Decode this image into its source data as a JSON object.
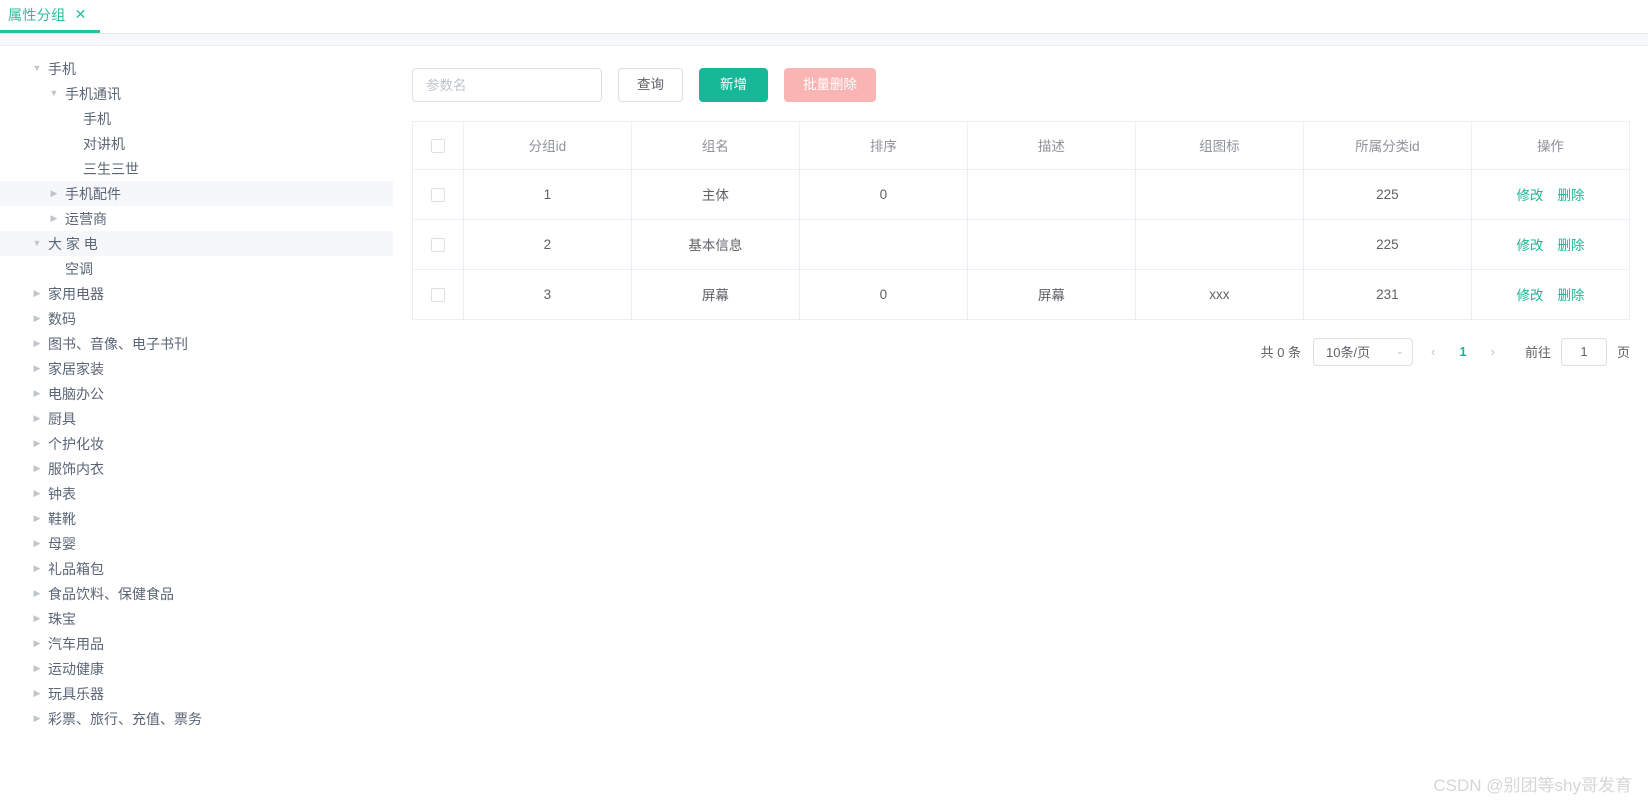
{
  "tab": {
    "label": "属性分组",
    "close_icon": "close-icon",
    "close_glyph": "✕"
  },
  "accent": {
    "teal": "#17b897",
    "pink": "#f9b4b4",
    "highlight": "#f5f7fa"
  },
  "sidebar": {
    "items": [
      {
        "label": "手机",
        "level": 0,
        "caret": "down",
        "highlight": false
      },
      {
        "label": "手机通讯",
        "level": 1,
        "caret": "down",
        "highlight": false
      },
      {
        "label": "手机",
        "level": 2,
        "caret": "none",
        "highlight": false
      },
      {
        "label": "对讲机",
        "level": 2,
        "caret": "none",
        "highlight": false
      },
      {
        "label": "三生三世",
        "level": 2,
        "caret": "none",
        "highlight": false
      },
      {
        "label": "手机配件",
        "level": 1,
        "caret": "right",
        "highlight": true
      },
      {
        "label": "运营商",
        "level": 1,
        "caret": "right",
        "highlight": false
      },
      {
        "label": "大 家 电",
        "level": 0,
        "caret": "down",
        "highlight": true
      },
      {
        "label": "空调",
        "level": 1,
        "caret": "none",
        "highlight": false
      },
      {
        "label": "家用电器",
        "level": 0,
        "caret": "right",
        "highlight": false
      },
      {
        "label": "数码",
        "level": 0,
        "caret": "right",
        "highlight": false
      },
      {
        "label": "图书、音像、电子书刊",
        "level": 0,
        "caret": "right",
        "highlight": false
      },
      {
        "label": "家居家装",
        "level": 0,
        "caret": "right",
        "highlight": false
      },
      {
        "label": "电脑办公",
        "level": 0,
        "caret": "right",
        "highlight": false
      },
      {
        "label": "厨具",
        "level": 0,
        "caret": "right",
        "highlight": false
      },
      {
        "label": "个护化妆",
        "level": 0,
        "caret": "right",
        "highlight": false
      },
      {
        "label": "服饰内衣",
        "level": 0,
        "caret": "right",
        "highlight": false
      },
      {
        "label": "钟表",
        "level": 0,
        "caret": "right",
        "highlight": false
      },
      {
        "label": "鞋靴",
        "level": 0,
        "caret": "right",
        "highlight": false
      },
      {
        "label": "母婴",
        "level": 0,
        "caret": "right",
        "highlight": false
      },
      {
        "label": "礼品箱包",
        "level": 0,
        "caret": "right",
        "highlight": false
      },
      {
        "label": "食品饮料、保健食品",
        "level": 0,
        "caret": "right",
        "highlight": false
      },
      {
        "label": "珠宝",
        "level": 0,
        "caret": "right",
        "highlight": false
      },
      {
        "label": "汽车用品",
        "level": 0,
        "caret": "right",
        "highlight": false
      },
      {
        "label": "运动健康",
        "level": 0,
        "caret": "right",
        "highlight": false
      },
      {
        "label": "玩具乐器",
        "level": 0,
        "caret": "right",
        "highlight": false
      },
      {
        "label": "彩票、旅行、充值、票务",
        "level": 0,
        "caret": "right",
        "highlight": false
      }
    ]
  },
  "toolbar": {
    "search_placeholder": "参数名",
    "search_value": "",
    "query_label": "查询",
    "add_label": "新增",
    "batch_delete_label": "批量删除"
  },
  "table": {
    "headers": [
      "",
      "分组id",
      "组名",
      "排序",
      "描述",
      "组图标",
      "所属分类id",
      "操作"
    ],
    "rows": [
      {
        "id": "1",
        "name": "主体",
        "sort": "0",
        "desc": "",
        "icon": "",
        "cat": "225"
      },
      {
        "id": "2",
        "name": "基本信息",
        "sort": "",
        "desc": "",
        "icon": "",
        "cat": "225"
      },
      {
        "id": "3",
        "name": "屏幕",
        "sort": "0",
        "desc": "屏幕",
        "icon": "xxx",
        "cat": "231"
      }
    ],
    "op_edit": "修改",
    "op_delete": "删除"
  },
  "pagination": {
    "total_text": "共 0 条",
    "page_size": "10条/页",
    "prev_glyph": "‹",
    "next_glyph": "›",
    "current_page": "1",
    "jump_label": "前往",
    "jump_value": "1",
    "jump_suffix": "页"
  },
  "watermark": {
    "text": "CSDN @别团等shy哥发育"
  }
}
